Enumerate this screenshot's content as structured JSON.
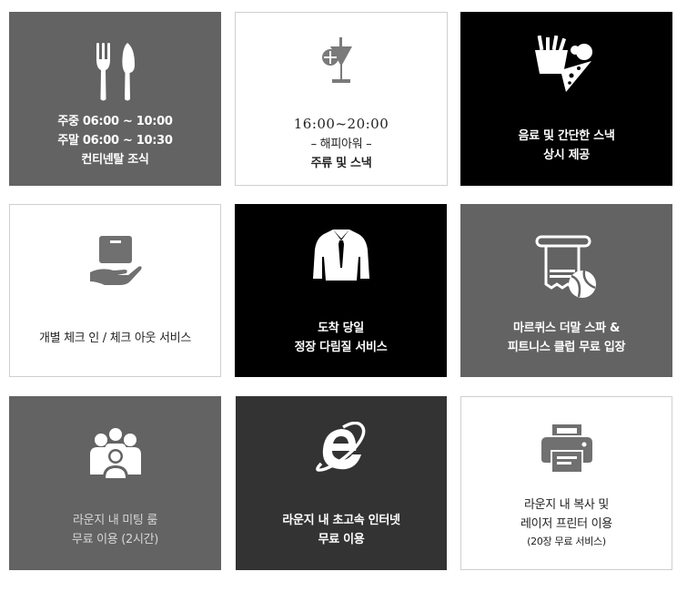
{
  "colors": {
    "gray": "#636363",
    "black": "#000000",
    "dark": "#333333",
    "white": "#ffffff",
    "border": "#cfcfcf"
  },
  "tiles": [
    {
      "icon": "fork-knife-icon",
      "lines": [
        "주중  06:00 ~ 10:00",
        "주말 06:00 ~ 10:30",
        "컨티넨탈 조식"
      ]
    },
    {
      "icon": "cocktail-glass-icon",
      "lines": [
        "16:00~20:00",
        "– 해피아워 –",
        "주류 및 스낵"
      ]
    },
    {
      "icon": "snacks-icon",
      "lines": [
        "음료 및 간단한 스낵",
        "상시 제공"
      ]
    },
    {
      "icon": "hand-luggage-icon",
      "lines": [
        "개별 체크 인 / 체크 아웃 서비스"
      ]
    },
    {
      "icon": "suit-shirt-icon",
      "lines": [
        "도착 당일",
        "정장 다림질 서비스"
      ]
    },
    {
      "icon": "towel-tennis-icon",
      "lines": [
        "마르퀴스 더말 스파 &",
        "피트니스 클럽 무료 입장"
      ]
    },
    {
      "icon": "meeting-people-icon",
      "lines": [
        "라운지 내 미팅 룸",
        "무료 이용 (2시간)"
      ]
    },
    {
      "icon": "internet-explorer-icon",
      "lines": [
        "라운지 내 초고속 인터넷",
        "무료 이용"
      ]
    },
    {
      "icon": "printer-icon",
      "lines": [
        "라운지 내 복사 및",
        "레이저 프린터 이용",
        "(20장 무료 서비스)"
      ]
    }
  ]
}
